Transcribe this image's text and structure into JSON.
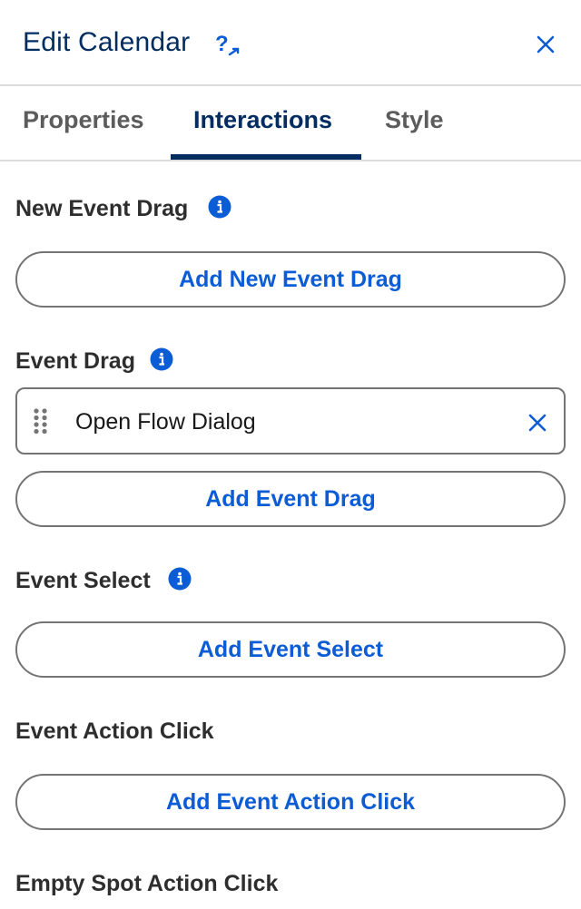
{
  "header": {
    "title": "Edit Calendar",
    "help_icon": "help-link-icon",
    "close_icon": "close-icon"
  },
  "tabs": [
    {
      "label": "Properties",
      "active": false
    },
    {
      "label": "Interactions",
      "active": true
    },
    {
      "label": "Style",
      "active": false
    }
  ],
  "sections": {
    "new_event_drag": {
      "label": "New Event Drag",
      "button": "Add New Event Drag"
    },
    "event_drag": {
      "label": "Event Drag",
      "items": [
        {
          "label": "Open Flow Dialog"
        }
      ],
      "button": "Add Event Drag"
    },
    "event_select": {
      "label": "Event Select",
      "button": "Add Event Select"
    },
    "event_action_click": {
      "label": "Event Action Click",
      "button": "Add Event Action Click"
    },
    "empty_spot_action_click": {
      "label": "Empty Spot Action Click"
    }
  },
  "colors": {
    "title": "#032d60",
    "accent": "#0b5cd5",
    "border": "#747474",
    "divider": "#dddbda"
  }
}
